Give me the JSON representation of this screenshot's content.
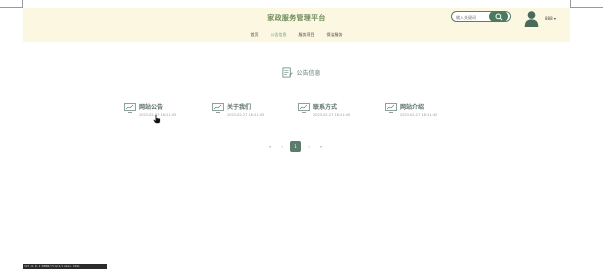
{
  "header": {
    "site_title": "家政服务管理平台",
    "search_placeholder": "输入关键词",
    "username": "888"
  },
  "nav": {
    "items": [
      {
        "label": "首页",
        "active": false
      },
      {
        "label": "公告信息",
        "active": true
      },
      {
        "label": "服务项目",
        "active": false
      },
      {
        "label": "保洁服务",
        "active": false
      }
    ]
  },
  "notice": {
    "title": "公告信息",
    "items": [
      {
        "title": "网站公告",
        "date": "2023-02-27 18:21:45"
      },
      {
        "title": "关于我们",
        "date": "2023-02-27 18:21:45"
      },
      {
        "title": "联系方式",
        "date": "2023-02-27 18:21:45"
      },
      {
        "title": "网站介绍",
        "date": "2023-02-27 18:21:45"
      }
    ]
  },
  "pagination": {
    "first": "«",
    "prev": "‹",
    "current": "1",
    "next": "›",
    "last": "»"
  },
  "statusbar": {
    "text": "127.0.0.1:8080/front/index.html"
  },
  "colors": {
    "header_bg": "#fcf7e1",
    "accent": "#5b7b6b",
    "title": "#6e8b5b"
  }
}
